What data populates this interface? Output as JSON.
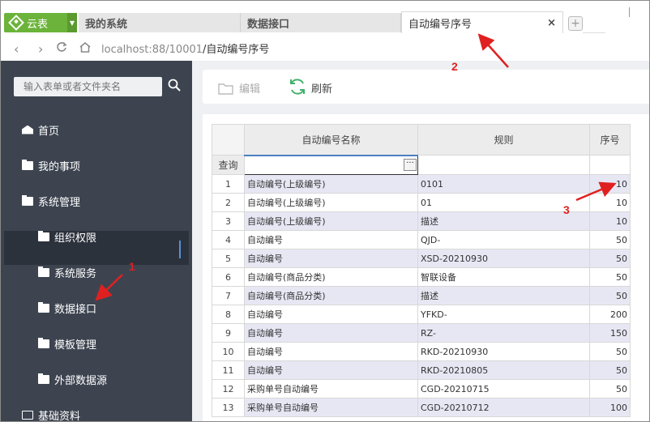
{
  "brand": {
    "label": "云表"
  },
  "tabs": [
    {
      "label": "我的系统"
    },
    {
      "label": "数据接口"
    },
    {
      "label": "自动编号序号",
      "close": "×"
    }
  ],
  "address": {
    "host": "localhost:88/10001",
    "path": "/自动编号序号"
  },
  "sidebar": {
    "search_placeholder": "输入表单或者文件夹名",
    "items": [
      {
        "label": "首页"
      },
      {
        "label": "我的事项"
      },
      {
        "label": "系统管理"
      },
      {
        "label": "组织权限"
      },
      {
        "label": "系统服务"
      },
      {
        "label": "数据接口"
      },
      {
        "label": "模板管理"
      },
      {
        "label": "外部数据源"
      },
      {
        "label": "基础资料"
      }
    ]
  },
  "toolbar": {
    "edit_label": "编辑",
    "refresh_label": "刷新"
  },
  "grid": {
    "headers": [
      "自动编号名称",
      "规则",
      "序号"
    ],
    "query_label": "查询",
    "dots": "···",
    "rows": [
      {
        "n": "1",
        "name": "自动编号(上级编号)",
        "rule": "0101",
        "seq": "10"
      },
      {
        "n": "2",
        "name": "自动编号(上级编号)",
        "rule": "01",
        "seq": "10"
      },
      {
        "n": "3",
        "name": "自动编号(上级编号)",
        "rule": "描述",
        "seq": "10"
      },
      {
        "n": "4",
        "name": "自动编号",
        "rule": "QJD-",
        "seq": "50"
      },
      {
        "n": "5",
        "name": "自动编号",
        "rule": "XSD-20210930",
        "seq": "50"
      },
      {
        "n": "6",
        "name": "自动编号(商品分类)",
        "rule": "智联设备",
        "seq": "50"
      },
      {
        "n": "7",
        "name": "自动编号(商品分类)",
        "rule": "描述",
        "seq": "50"
      },
      {
        "n": "8",
        "name": "自动编号",
        "rule": "YFKD-",
        "seq": "200"
      },
      {
        "n": "9",
        "name": "自动编号",
        "rule": "RZ-",
        "seq": "150"
      },
      {
        "n": "10",
        "name": "自动编号",
        "rule": "RKD-20210930",
        "seq": "50"
      },
      {
        "n": "11",
        "name": "自动编号",
        "rule": "RKD-20210805",
        "seq": "50"
      },
      {
        "n": "12",
        "name": "采购单号自动编号",
        "rule": "CGD-20210715",
        "seq": "50"
      },
      {
        "n": "13",
        "name": "采购单号自动编号",
        "rule": "CGD-20210712",
        "seq": "100"
      }
    ]
  },
  "annotations": [
    "1",
    "2",
    "3"
  ],
  "colors": {
    "brand": "#6bb33a",
    "sidebar": "#3d4450",
    "annotation": "#e02020",
    "row_alt": "#e7e7f4"
  }
}
